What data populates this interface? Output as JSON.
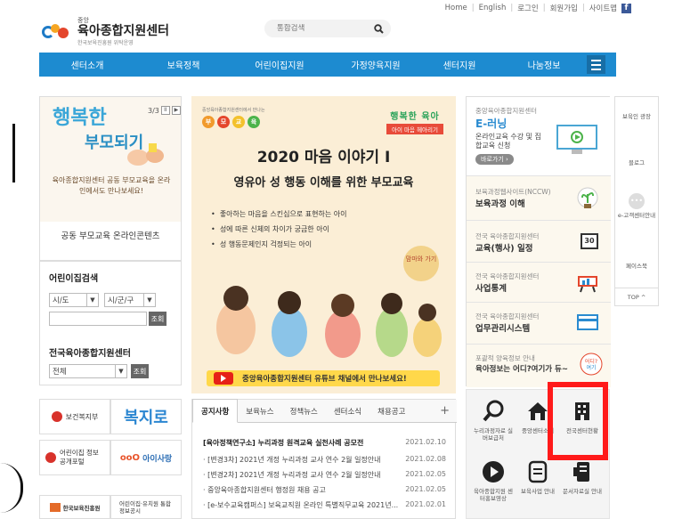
{
  "util": {
    "home": "Home",
    "english": "English",
    "login": "로그인",
    "join": "회원가입",
    "sitemap": "사이트맵",
    "facebook": "f"
  },
  "logo": {
    "small": "중앙",
    "main": "육아종합지원센터",
    "sub": "한국보육진흥원 위탁운영"
  },
  "search": {
    "placeholder": "통합검색"
  },
  "nav": {
    "items": [
      "센터소개",
      "보육정책",
      "어린이집지원",
      "가정양육지원",
      "센터지원",
      "나눔정보"
    ]
  },
  "promo": {
    "title_a": "행복한",
    "title_b": "부모되기",
    "page": "3/3",
    "note": "육아종합지원센터 공동 부모교육을 온라인에서도 만나보세요!",
    "caption": "공동 부모교육 온라인콘텐츠"
  },
  "daycare": {
    "title": "어린이집검색",
    "sido": "시/도",
    "sigungu": "시/군/구",
    "search_btn": "조회",
    "center_title": "전국육아종합지원센터",
    "all": "전체",
    "search_btn2": "조회"
  },
  "banners": {
    "mohw": "보건복지부",
    "bokjiro": "복지로",
    "daycare_info": "어린이집 정보공개포털",
    "aisarang": "아이사랑",
    "kcpi": "한국보육진흥원",
    "eval": "어린이집·유치원 통합정보공시"
  },
  "main_art": {
    "small": "중앙육아종합지원센터에서 만나는",
    "logo": [
      "부",
      "모",
      "교",
      "육"
    ],
    "right_1": "행복한 육아",
    "right_2": "아이 마음 헤아리기",
    "h1": "2020 마음 이야기 I",
    "h2": "영유아 성 행동 이해를 위한 부모교육",
    "bullets": [
      "좋아하는 마음을 스킨십으로 표현하는 아이",
      "성에 따른 신체의 차이가 궁금한 아이",
      "성 행동문제인지 걱정되는 아이"
    ],
    "bubble": "맘마와 가기",
    "youtube": "중앙육아종합지원센터 유튜브 채널에서 만나보세요!"
  },
  "notice": {
    "tabs": [
      "공지사항",
      "보육뉴스",
      "정책뉴스",
      "센터소식",
      "채용공고"
    ],
    "plus": "+",
    "rows": [
      {
        "title": "[육아정책연구소] 누리과정 원격교육 실천사례 공모전",
        "date": "2021.02.10"
      },
      {
        "title": "· [변경3차] 2021년 개정 누리과정 교사 연수 2월 일정안내",
        "date": "2021.02.08"
      },
      {
        "title": "· [변경2차] 2021년 개정 누리과정 교사 연수 2월 일정안내",
        "date": "2021.02.05"
      },
      {
        "title": "· 중앙육아종합지원센터 행정원 채용 공고",
        "date": "2021.02.05"
      },
      {
        "title": "· [e-보수교육캠퍼스] 보육교직원 온라인 특별직무교육 2021년...",
        "date": "2021.02.01"
      }
    ]
  },
  "right": {
    "elearn_s": "중앙육아종합지원센터",
    "elearn_m": "E-러닝",
    "elearn_d": "온라인교육 수강 및 집합교육 신청",
    "elearn_btn": "바로가기",
    "nccw_s": "보육과정웹사이트(NCCW)",
    "nccw_m": "보육과정 이해",
    "edu_s": "전국 육아종합지원센터",
    "edu_m": "교육(행사) 일정",
    "cal": "30",
    "stat_s": "전국 육아종합지원센터",
    "stat_m": "사업통계",
    "sys_s": "전국 육아종합지원센터",
    "sys_m": "업무관리시스템",
    "where_s": "포괄적 양육정보 안내",
    "where_m": "육아정보는 어디?여기가 듀~"
  },
  "quick": [
    {
      "label": "누리과정자료 실버보급처"
    },
    {
      "label": "중앙센터소개"
    },
    {
      "label": "전국센터현황"
    },
    {
      "label": "육아종합지원 센터홍보영상"
    },
    {
      "label": "보육사업 안내"
    },
    {
      "label": "문서자료실 안내"
    }
  ],
  "side": {
    "items": [
      "보육인 광장",
      "블로그",
      "e-고객센터안내",
      "페이스북"
    ],
    "top": "TOP"
  },
  "colors": {
    "nav": "#1d8bd0",
    "accent_red": "#ff1a1a",
    "youtube": "#e62117"
  }
}
